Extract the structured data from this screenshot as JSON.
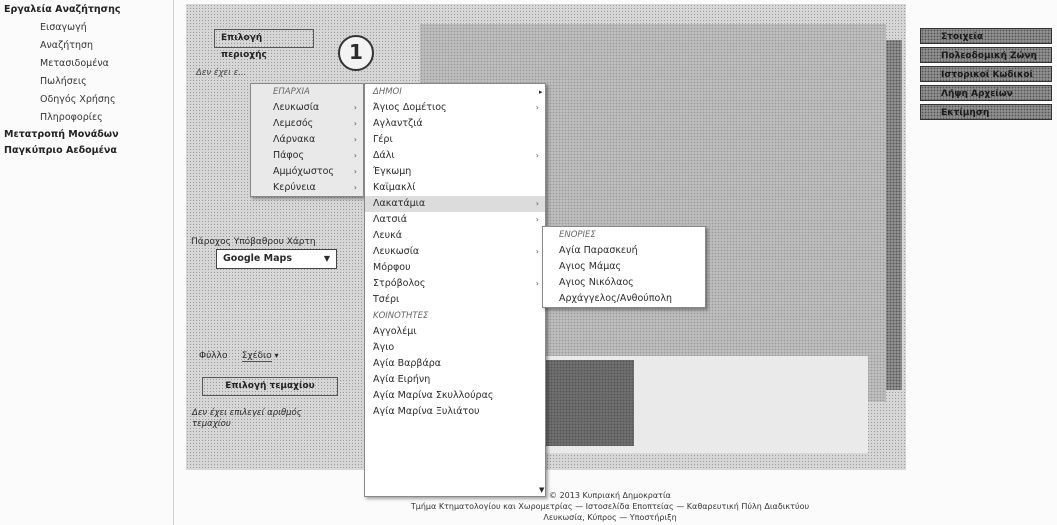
{
  "nav": {
    "title": "Εργαλεία Αναζήτησης",
    "items": [
      "Εισαγωγή",
      "Αναζήτηση",
      "Μετασιδομένα",
      "Πωλήσεις",
      "Οδηγός Χρήσης",
      "Πληροφορίες"
    ],
    "top_items": [
      "Μετατροπή Μονάδων",
      "Παγκύπριο Αεδομένα"
    ]
  },
  "controls": {
    "select_area_label": "Επιλογή περιοχής",
    "area_badge": "1",
    "no_area_text": "Δεν έχει ε...",
    "provider_label": "Πάροχος Υπόβαθρου Χάρτη",
    "provider_value": "Google Maps",
    "filter_label": "Φύλλο",
    "filter_value": "Σχέδιο",
    "select_plot_label": "Επιλογή τεμαχίου",
    "no_plot_text": "Δεν έχει επιλεγεί αριθμός τεμαχίου"
  },
  "menus": {
    "districts_header": "ΕΠΑΡΧΙΑ",
    "districts": [
      "Λευκωσία",
      "Λεμεσός",
      "Λάρνακα",
      "Πάφος",
      "Αμμόχωστος",
      "Κερύνεια"
    ],
    "municipalities_header": "ΔΗΜΟΙ",
    "municipalities": [
      "Άγιος Δομέτιος",
      "Αγλαντζιά",
      "Γέρι",
      "Δάλι",
      "Έγκωμη",
      "Καϊμακλί",
      "Λακατάμια",
      "Λατσιά",
      "Λευκά",
      "Λευκωσία",
      "Μόρφου",
      "Στρόβολος",
      "Τσέρι"
    ],
    "communities_header": "ΚΟΙΝΟΤΗΤΕΣ",
    "communities": [
      "Αγγολέμι",
      "Άγιο",
      "Αγία Βαρβάρα",
      "Αγία Ειρήνη",
      "Αγία Μαρίνα Σκυλλούρας",
      "Αγία Μαρίνα Ξυλιάτου"
    ],
    "parishes_header": "ΕΝΟΡΙΕΣ",
    "parishes": [
      "Αγία Παρασκευή",
      "Αγιος Μάμας",
      "Αγιος Νικόλαος",
      "Αρχάγγελος/Ανθούπολη"
    ]
  },
  "tools": [
    "Στοιχεία",
    "Πολεοδομική Ζώνη",
    "Ιστορικοί Κωδικοί",
    "Λήψη Αρχείων",
    "Εκτίμηση"
  ],
  "footer": {
    "line1": "© 2013 Κυπριακή Δημοκρατία",
    "line2": "Τμήμα Κτηματολογίου και Χωρομετρίας — Ιστοσελίδα Εποπτείας — Καθαρευτική Πύλη Διαδικτύου",
    "line3": "Λευκωσία, Κύπρος — Υποστήριξη"
  }
}
